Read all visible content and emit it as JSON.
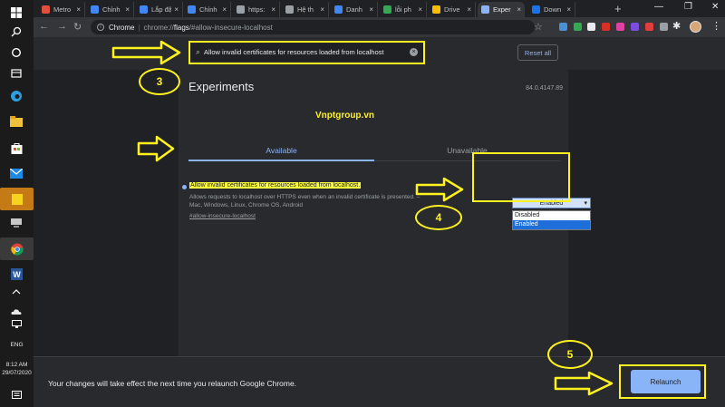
{
  "taskbar": {
    "language": "ENG",
    "time": "8:12 AM",
    "date": "29/07/2020"
  },
  "tabs": [
    {
      "label": "Metro",
      "icon": "metro-icon",
      "color": "#e04f3a"
    },
    {
      "label": "Chỉnh",
      "icon": "doc-icon",
      "color": "#4285f4"
    },
    {
      "label": "Lắp đặ",
      "icon": "doc-icon",
      "color": "#4285f4"
    },
    {
      "label": "Chỉnh",
      "icon": "doc-icon",
      "color": "#4285f4"
    },
    {
      "label": "https:",
      "icon": "page-icon",
      "color": "#9aa0a6"
    },
    {
      "label": "Hệ th",
      "icon": "globe-icon",
      "color": "#9aa0a6"
    },
    {
      "label": "Danh",
      "icon": "doc-icon",
      "color": "#4285f4"
    },
    {
      "label": "lỗi ph",
      "icon": "google-icon",
      "color": "#34a853"
    },
    {
      "label": "Drive",
      "icon": "drive-icon",
      "color": "#fbbc04"
    },
    {
      "label": "Exper",
      "icon": "flask-icon",
      "color": "#8ab4f8",
      "active": true
    },
    {
      "label": "Down",
      "icon": "translate-icon",
      "color": "#1a73e8"
    }
  ],
  "toolbar": {
    "site": "Chrome",
    "url_prefix": "chrome://",
    "url_host": "flags",
    "url_rest": "/#allow-insecure-localhost"
  },
  "search": {
    "value": "Allow invalid certificates for resources loaded from localhost"
  },
  "reset_all": "Reset all",
  "experiments": {
    "title": "Experiments",
    "version": "84.0.4147.89",
    "tab_available": "Available",
    "tab_unavailable": "Unavailable"
  },
  "flag": {
    "name": "Allow invalid certificates for resources loaded from localhost.",
    "desc_line1": "Allows requests to localhost over HTTPS even when an invalid certificate is presented. –",
    "desc_line2": "Mac, Windows, Linux, Chrome OS, Android",
    "link": "#allow-insecure-localhost",
    "selected": "Enabled",
    "options": [
      "Disabled",
      "Enabled"
    ]
  },
  "watermark": "Vnptgroup.vn",
  "footer": {
    "message": "Your changes will take effect the next time you relaunch Google Chrome.",
    "relaunch": "Relaunch"
  },
  "steps": {
    "s3": "3",
    "s4": "4",
    "s5": "5"
  },
  "colors": {
    "annotation": "#fff21e",
    "accent": "#8ab4f8",
    "background": "#202124"
  }
}
